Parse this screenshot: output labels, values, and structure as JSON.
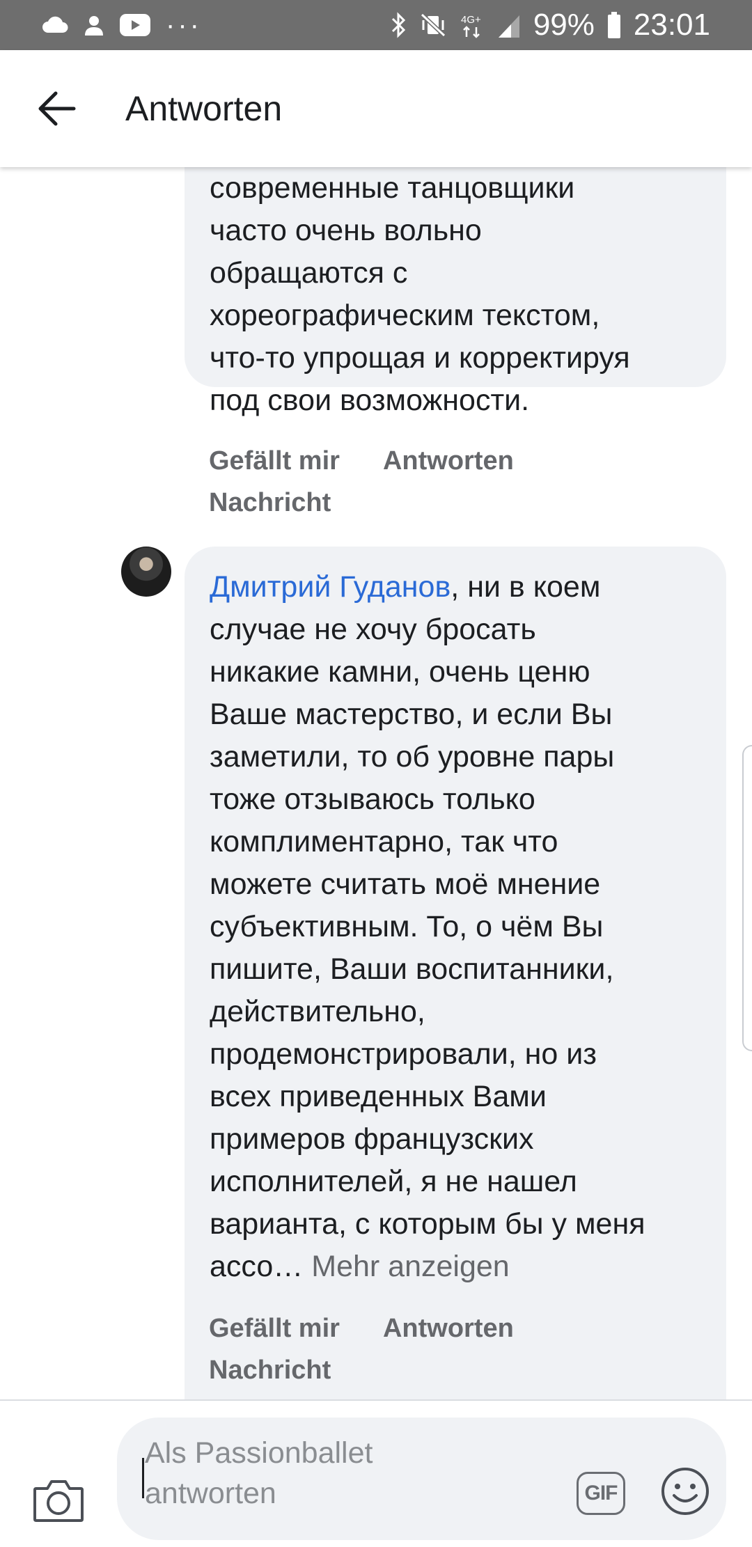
{
  "status_bar": {
    "icons_left": [
      "cloud-icon",
      "person-icon",
      "youtube-icon"
    ],
    "overflow": "···",
    "icons_right": [
      "bluetooth-icon",
      "vibrate-off-icon",
      "network-4g-icon",
      "signal-icon",
      "battery-icon"
    ],
    "network_label": "4G+",
    "battery": "99%",
    "time": "23:01"
  },
  "header": {
    "title": "Antworten",
    "back_icon": "arrow-left-icon"
  },
  "comments": [
    {
      "lines": [
        "современные танцовщики",
        "часто очень вольно",
        "обращаются с",
        "хореографическим текстом,",
        "что-то упрощая и корректируя",
        "под свои возможности."
      ],
      "actions": {
        "like": "Gefällt mir",
        "reply": "Antworten",
        "message": "Nachricht"
      }
    },
    {
      "mention": "Дмитрий Гуданов",
      "first_line_rest": ", ни в коем",
      "lines": [
        "случае не хочу бросать",
        "никакие камни, очень ценю",
        "Ваше мастерство, и если Вы",
        "заметили, то об уровне пары",
        "тоже отзываюсь только",
        "комплиментарно, так что",
        "можете считать моё мнение",
        "субъективным. То, о чём Вы",
        "пишите, Ваши воспитанники,",
        "действительно,",
        "продемонстрировали, но из",
        "всех приведенных Вами",
        "примеров французских",
        "исполнителей, я не нашел",
        "варианта, с которым бы у меня"
      ],
      "last_line": "ассо…",
      "more": " Mehr anzeigen",
      "actions": {
        "like": "Gefällt mir",
        "reply": "Antworten",
        "message": "Nachricht"
      }
    }
  ],
  "composer": {
    "placeholder_line1": "Als Passionballet",
    "placeholder_line2": "antworten",
    "gif_label": "GIF",
    "camera_icon": "camera-icon",
    "emoji_icon": "smiley-icon"
  },
  "colors": {
    "status_bar": "#6e6e6e",
    "bubble": "#f0f2f5",
    "mention": "#2a6ad6",
    "secondary_text": "#65676b"
  }
}
